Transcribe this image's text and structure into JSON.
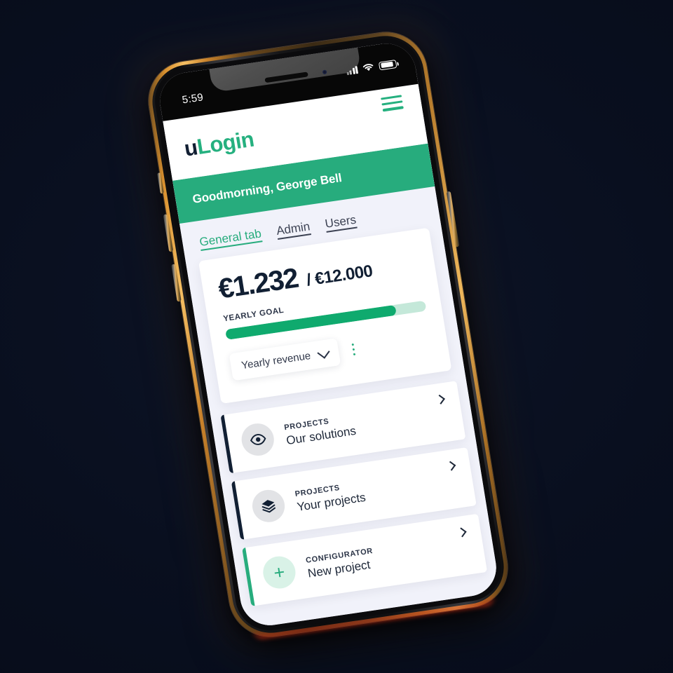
{
  "status_bar": {
    "time": "5:59",
    "signal_icon": "signal-bars-icon",
    "wifi_icon": "wifi-icon",
    "battery_icon": "battery-icon"
  },
  "header": {
    "logo_primary": "u",
    "logo_secondary": "Login",
    "menu_icon": "hamburger-menu-icon"
  },
  "greeting": {
    "text": "Goodmorning, George Bell"
  },
  "tabs": [
    {
      "label": "General tab",
      "active": true
    },
    {
      "label": "Admin",
      "active": false
    },
    {
      "label": "Users",
      "active": false
    }
  ],
  "goal_card": {
    "amount_current": "€1.232",
    "amount_target": "/ €12.000",
    "label": "YEARLY GOAL",
    "progress_percent": 85,
    "select_value": "Yearly revenue",
    "select_icon": "chevron-down-icon",
    "more_icon": "kebab-menu-icon"
  },
  "list": [
    {
      "kicker": "PROJECTS",
      "title": "Our solutions",
      "icon": "eye-icon",
      "bar_color": "#111f33",
      "icon_bg": "#e2e3e6",
      "icon_fg": "#111f33",
      "chevron_icon": "chevron-right-icon"
    },
    {
      "kicker": "PROJECTS",
      "title": "Your projects",
      "icon": "layers-icon",
      "bar_color": "#111f33",
      "icon_bg": "#e2e3e6",
      "icon_fg": "#111f33",
      "chevron_icon": "chevron-right-icon"
    },
    {
      "kicker": "CONFIGURATOR",
      "title": "New project",
      "icon": "plus-icon",
      "bar_color": "#27ac7d",
      "icon_bg": "#d9f2e7",
      "icon_fg": "#27ac7d",
      "chevron_icon": "chevron-right-icon"
    }
  ],
  "colors": {
    "brand_green": "#27ac7d",
    "progress_green": "#0faa6e",
    "progress_track": "#c4e8d9",
    "navy": "#111f33",
    "app_bg": "#f1f2fa",
    "scene_bg": "#0a1021",
    "phone_frame_gold": "#d9912f"
  }
}
